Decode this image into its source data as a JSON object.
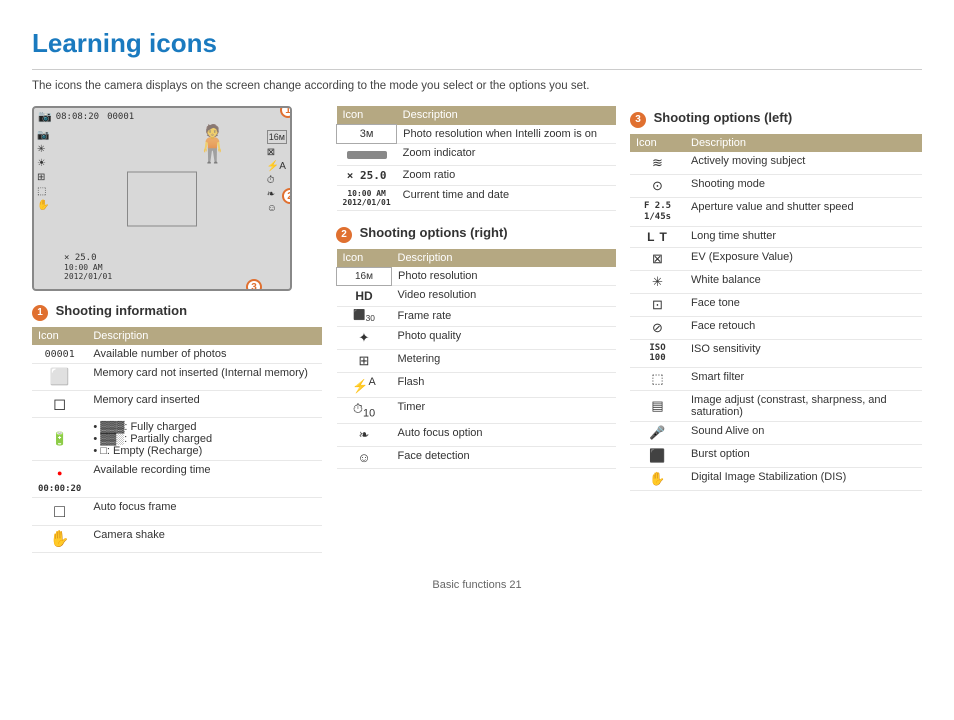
{
  "page": {
    "title": "Learning icons",
    "subtitle": "The icons the camera displays on the screen change according to the mode you select or the options you set.",
    "footer": "Basic functions   21"
  },
  "camera_preview": {
    "top_bar": "08:08:20",
    "frame_count": "00001",
    "bottom_text1": "× 25.0",
    "bottom_text2": "10:00 AM",
    "bottom_text3": "2012/01/01",
    "badge1": "1",
    "badge2": "2",
    "badge3": "3"
  },
  "section1": {
    "number": "1",
    "title": "Shooting information",
    "col_icon": "Icon",
    "col_desc": "Description",
    "rows": [
      {
        "icon": "00001",
        "desc": "Available number of photos"
      },
      {
        "icon": "⬜",
        "desc": "Memory card not inserted (Internal memory)"
      },
      {
        "icon": "◻",
        "desc": "Memory card inserted"
      },
      {
        "icon": "🔋",
        "desc": ""
      },
      {
        "icon": "●00:00:20",
        "desc": "Available recording time"
      },
      {
        "icon": "□",
        "desc": "Auto focus frame"
      },
      {
        "icon": "☞",
        "desc": "Camera shake"
      }
    ],
    "battery_items": [
      "▓▓▓: Fully charged",
      "▓▓░: Partially charged",
      "□: Empty (Recharge)"
    ]
  },
  "section2": {
    "number": "2",
    "title": "Shooting options (right)",
    "col_icon": "Icon",
    "col_desc": "Description",
    "rows": [
      {
        "icon": "16м",
        "desc": "Photo resolution"
      },
      {
        "icon": "HD",
        "desc": "Video resolution"
      },
      {
        "icon": "⌧30",
        "desc": "Frame rate"
      },
      {
        "icon": "✦",
        "desc": "Photo quality"
      },
      {
        "icon": "⊞",
        "desc": "Metering"
      },
      {
        "icon": "⚡A",
        "desc": "Flash"
      },
      {
        "icon": "⏱10",
        "desc": "Timer"
      },
      {
        "icon": "❧",
        "desc": "Auto focus option"
      },
      {
        "icon": "☺",
        "desc": "Face detection"
      }
    ]
  },
  "section3": {
    "number": "3",
    "title": "Shooting options (left)",
    "col_icon": "Icon",
    "col_desc": "Description",
    "rows": [
      {
        "icon": "≋",
        "desc": "Actively moving subject"
      },
      {
        "icon": "⊙",
        "desc": "Shooting mode"
      },
      {
        "icon": "F2.5\n1/45s",
        "desc": "Aperture value and shutter speed"
      },
      {
        "icon": "LT",
        "desc": "Long time shutter"
      },
      {
        "icon": "⊠",
        "desc": "EV (Exposure Value)"
      },
      {
        "icon": "✳",
        "desc": "White balance"
      },
      {
        "icon": "⊡",
        "desc": "Face tone"
      },
      {
        "icon": "⊘",
        "desc": "Face retouch"
      },
      {
        "icon": "ISO\n100",
        "desc": "ISO sensitivity"
      },
      {
        "icon": "⬚",
        "desc": "Smart filter"
      },
      {
        "icon": "▤",
        "desc": "Image adjust (constrast, sharpness, and saturation)"
      },
      {
        "icon": "🎤",
        "desc": "Sound Alive on"
      },
      {
        "icon": "⬛",
        "desc": "Burst option"
      },
      {
        "icon": "✋",
        "desc": "Digital Image Stabilization (DIS)"
      }
    ]
  },
  "shooting_info_table_header": {
    "icon": "Icon",
    "description": "Description"
  },
  "icons_map": {
    "search": "🔍",
    "gear": "⚙",
    "close": "✕"
  }
}
